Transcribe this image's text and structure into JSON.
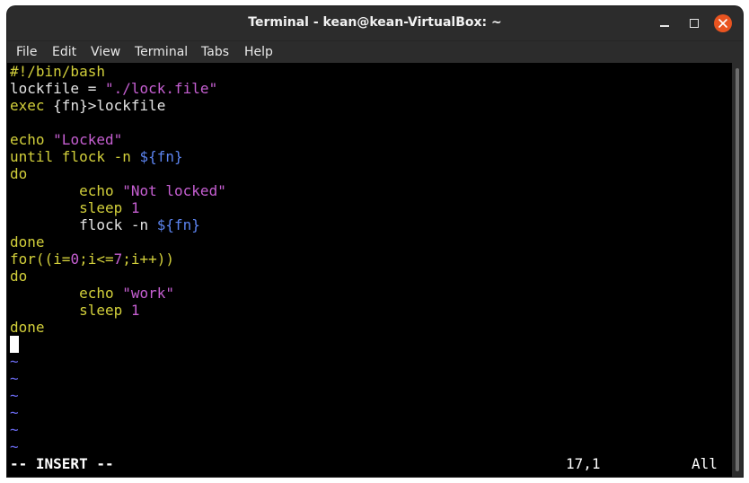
{
  "window": {
    "title": "Terminal - kean@kean-VirtualBox: ~",
    "accent_color": "#e95420"
  },
  "menu": {
    "items": [
      "File",
      "Edit",
      "View",
      "Terminal",
      "Tabs",
      "Help"
    ]
  },
  "editor": {
    "lines": {
      "l1": "#!/bin/bash",
      "l2a": "lockfile = ",
      "l2b": "\"./lock.file\"",
      "l3a": "exec ",
      "l3b": "{fn}",
      "l3c": ">lockfile",
      "l5a": "echo ",
      "l5b": "\"Locked\"",
      "l6a": "until ",
      "l6b": "flock -n ",
      "l6c": "${fn}",
      "l7": "do",
      "l8a": "        echo ",
      "l8b": "\"Not locked\"",
      "l9a": "        sleep ",
      "l9b": "1",
      "l10a": "        flock -n ",
      "l10b": "${fn}",
      "l11": "done",
      "l12a": "for((i=",
      "l12b": "0",
      "l12c": ";i<=",
      "l12d": "7",
      "l12e": ";i++))",
      "l13": "do",
      "l14a": "        echo ",
      "l14b": "\"work\"",
      "l15a": "        sleep ",
      "l15b": "1",
      "l16": "done"
    },
    "tilde": "~",
    "colors": {
      "keyword": "#d3d03b",
      "string": "#c65fd2",
      "variable": "#5c84f0",
      "tilde": "#6a6af0",
      "background": "#000000"
    }
  },
  "status": {
    "mode": "-- INSERT --",
    "position": "17,1",
    "view": "All"
  }
}
